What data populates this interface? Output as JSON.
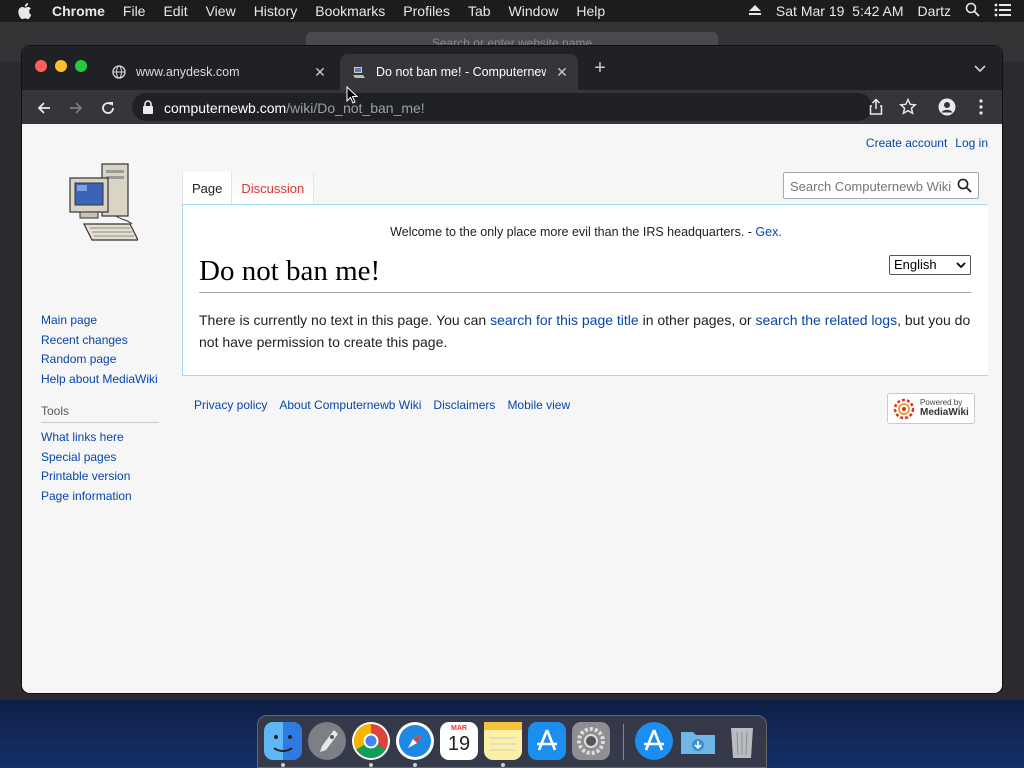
{
  "menubar": {
    "app": "Chrome",
    "items": [
      "File",
      "Edit",
      "View",
      "History",
      "Bookmarks",
      "Profiles",
      "Tab",
      "Window",
      "Help"
    ],
    "clock": "Sat Mar 19  5:42 AM",
    "user": "Dartz"
  },
  "background_window": {
    "address_placeholder": "Search or enter website name"
  },
  "tabs": [
    {
      "title": "www.anydesk.com"
    },
    {
      "title": "Do not ban me! - Computernewb Wiki"
    }
  ],
  "address": {
    "domain": "computernewb.com",
    "path": "/wiki/Do_not_ban_me!"
  },
  "page": {
    "personal": {
      "create_account": "Create account",
      "log_in": "Log in"
    },
    "nav_links": [
      "Main page",
      "Recent changes",
      "Random page",
      "Help about MediaWiki"
    ],
    "tools_heading": "Tools",
    "tool_links": [
      "What links here",
      "Special pages",
      "Printable version",
      "Page information"
    ],
    "tab_page": "Page",
    "tab_discussion": "Discussion",
    "search_placeholder": "Search Computernewb Wiki",
    "sitenotice_text": "Welcome to the only place more evil than the IRS headquarters. - ",
    "sitenotice_link": "Gex.",
    "title": "Do not ban me!",
    "language": "English",
    "body": {
      "t1": "There is currently no text in this page. You can ",
      "l1": "search for this page title",
      "t2": " in other pages, or ",
      "l2": "search the related logs",
      "t3": ", but you do not have permission to create this page."
    },
    "footer_links": [
      "Privacy policy",
      "About Computernewb Wiki",
      "Disclaimers",
      "Mobile view"
    ],
    "powered_small": "Powered by",
    "powered_big": "MediaWiki"
  },
  "dock": {
    "calendar_month": "MAR",
    "calendar_day": "19",
    "apps": [
      "finder-icon",
      "launchpad-icon",
      "chrome-icon",
      "safari-icon",
      "calendar-icon",
      "notes-icon",
      "app-store-icon",
      "system-preferences-icon",
      "app-store-2-icon",
      "downloads-folder-icon",
      "trash-icon"
    ]
  },
  "colors": {
    "link": "#0645ad",
    "redlink": "#dd3333",
    "chrome_dark": "#202124",
    "chrome_toolbar": "#35363a"
  }
}
